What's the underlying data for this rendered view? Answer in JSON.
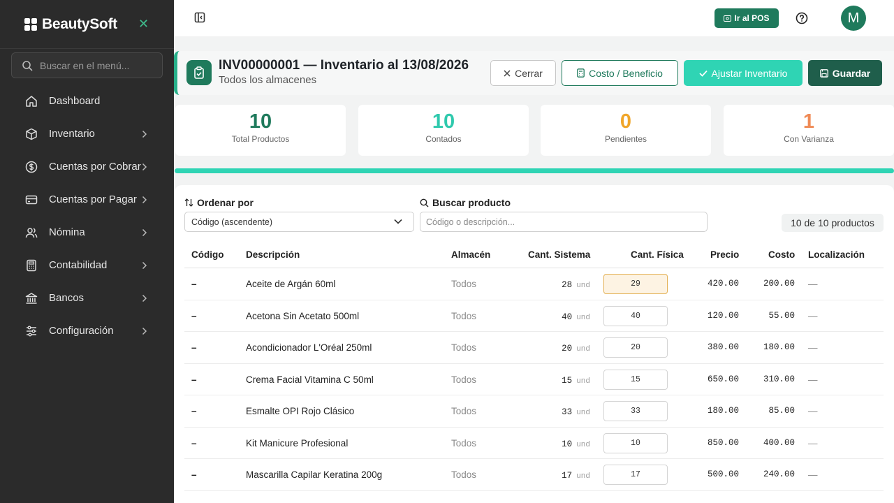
{
  "brand": {
    "name": "BeautySoft"
  },
  "menu_search": {
    "placeholder": "Buscar en el menú..."
  },
  "nav": [
    {
      "label": "Dashboard",
      "icon": "home-icon",
      "chevron": false
    },
    {
      "label": "Inventario",
      "icon": "box-icon",
      "chevron": true
    },
    {
      "label": "Cuentas por Cobrar",
      "icon": "dollar-circle-icon",
      "chevron": true
    },
    {
      "label": "Cuentas por Pagar",
      "icon": "credit-card-icon",
      "chevron": true
    },
    {
      "label": "Nómina",
      "icon": "users-icon",
      "chevron": true
    },
    {
      "label": "Contabilidad",
      "icon": "calculator-icon",
      "chevron": true
    },
    {
      "label": "Bancos",
      "icon": "bank-icon",
      "chevron": true
    },
    {
      "label": "Configuración",
      "icon": "sliders-icon",
      "chevron": true
    }
  ],
  "topbar": {
    "pos_label": "Ir al POS",
    "avatar_initial": "M"
  },
  "header": {
    "title": "INV00000001 — Inventario al 13/08/2026",
    "subtitle": "Todos los almacenes",
    "close_label": "Cerrar",
    "cost_label": "Costo / Beneficio",
    "adjust_label": "Ajustar Inventario",
    "save_label": "Guardar"
  },
  "stats": [
    {
      "value": "10",
      "label": "Total Productos",
      "color": "#1f7a5c"
    },
    {
      "value": "10",
      "label": "Contados",
      "color": "#2fc9ad"
    },
    {
      "value": "0",
      "label": "Pendientes",
      "color": "#f0a62a"
    },
    {
      "value": "1",
      "label": "Con Varianza",
      "color": "#ef8a55"
    }
  ],
  "progress": {
    "fraction": 1.0
  },
  "controls": {
    "sort_label": "Ordenar por",
    "sort_value": "Código (ascendente)",
    "search_label": "Buscar producto",
    "search_placeholder": "Código o descripción...",
    "count_text": "10 de 10 productos"
  },
  "table": {
    "headers": [
      "Código",
      "Descripción",
      "Almacén",
      "Cant. Sistema",
      "Cant. Física",
      "Precio",
      "Costo",
      "Localización"
    ],
    "unit": "und",
    "rows": [
      {
        "code": "–",
        "desc": "Aceite de Argán 60ml",
        "warehouse": "Todos",
        "system": "28",
        "physical": "29",
        "price": "420.00",
        "cost": "200.00",
        "location": "—",
        "variance": true
      },
      {
        "code": "–",
        "desc": "Acetona Sin Acetato 500ml",
        "warehouse": "Todos",
        "system": "40",
        "physical": "40",
        "price": "120.00",
        "cost": "55.00",
        "location": "—",
        "variance": false
      },
      {
        "code": "–",
        "desc": "Acondicionador L'Oréal 250ml",
        "warehouse": "Todos",
        "system": "20",
        "physical": "20",
        "price": "380.00",
        "cost": "180.00",
        "location": "—",
        "variance": false
      },
      {
        "code": "–",
        "desc": "Crema Facial Vitamina C 50ml",
        "warehouse": "Todos",
        "system": "15",
        "physical": "15",
        "price": "650.00",
        "cost": "310.00",
        "location": "—",
        "variance": false
      },
      {
        "code": "–",
        "desc": "Esmalte OPI Rojo Clásico",
        "warehouse": "Todos",
        "system": "33",
        "physical": "33",
        "price": "180.00",
        "cost": "85.00",
        "location": "—",
        "variance": false
      },
      {
        "code": "–",
        "desc": "Kit Manicure Profesional",
        "warehouse": "Todos",
        "system": "10",
        "physical": "10",
        "price": "850.00",
        "cost": "400.00",
        "location": "—",
        "variance": false
      },
      {
        "code": "–",
        "desc": "Mascarilla Capilar Keratina 200g",
        "warehouse": "Todos",
        "system": "17",
        "physical": "17",
        "price": "500.00",
        "cost": "240.00",
        "location": "—",
        "variance": false
      }
    ]
  }
}
